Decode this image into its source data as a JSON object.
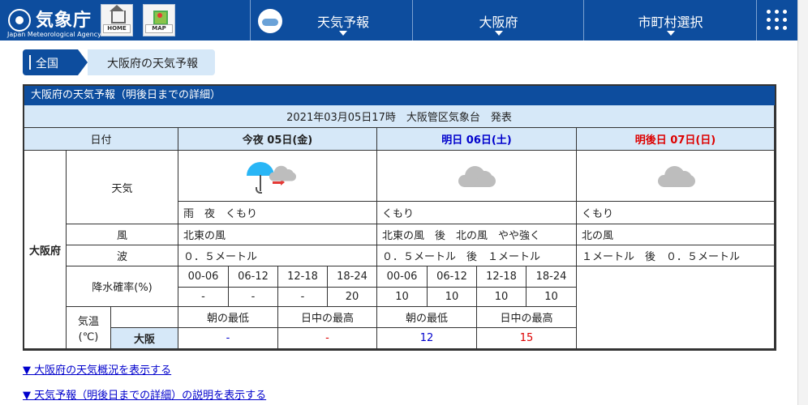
{
  "header": {
    "logo_title": "気象庁",
    "logo_sub": "Japan Meteorological Agency",
    "home_label": "HOME",
    "map_label": "MAP",
    "nav": [
      "天気予報",
      "大阪府",
      "市町村選択"
    ]
  },
  "breadcrumb": [
    "全国",
    "大阪府の天気予報"
  ],
  "forecast": {
    "title": "大阪府の天気予報（明後日までの詳細）",
    "issued": "2021年03月05日17時　大阪管区気象台　発表",
    "date_label": "日付",
    "days": [
      {
        "label": "今夜 05日(金)",
        "weather": "雨　夜　くもり",
        "wind": "北東の風",
        "wave": "０．５メートル"
      },
      {
        "label": "明日 06日(土)",
        "weather": "くもり",
        "wind": "北東の風　後　北の風　やや強く",
        "wave": "０．５メートル　後　１メートル"
      },
      {
        "label": "明後日 07日(日)",
        "weather": "くもり",
        "wind": "北の風",
        "wave": "１メートル　後　０．５メートル"
      }
    ],
    "region": "大阪府",
    "row_labels": {
      "weather": "天気",
      "wind": "風",
      "wave": "波",
      "pop": "降水確率(%)"
    },
    "pop_times": [
      "00-06",
      "06-12",
      "12-18",
      "18-24"
    ],
    "pop_today": [
      "-",
      "-",
      "-",
      "20"
    ],
    "pop_tomorrow": [
      "10",
      "10",
      "10",
      "10"
    ],
    "temp": {
      "label_line1": "気温",
      "label_line2": "(℃)",
      "min_label": "朝の最低",
      "max_label": "日中の最高",
      "city": "大阪",
      "today_min": "-",
      "today_max": "-",
      "tomorrow_min": "12",
      "tomorrow_max": "15"
    }
  },
  "links": [
    "▼ 大阪府の天気概況を表示する",
    "▼ 天気予報（明後日までの詳細）の説明を表示する"
  ]
}
